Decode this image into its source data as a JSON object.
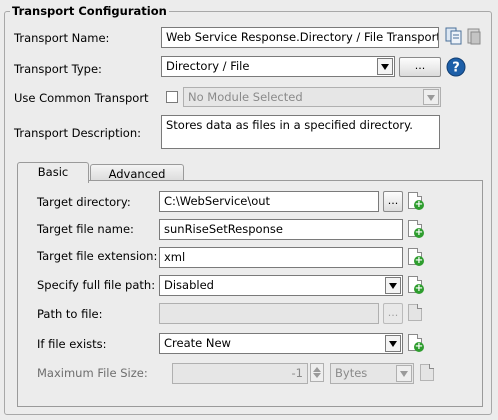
{
  "section_title": "Transport Configuration",
  "transport": {
    "name_label": "Transport Name:",
    "name_value": "Web Service Response.Directory / File Transport",
    "type_label": "Transport Type:",
    "type_value": "Directory / File",
    "type_browse": "...",
    "common_label": "Use Common Transport",
    "common_value": "No Module Selected",
    "desc_label": "Transport Description:",
    "desc_value": "Stores data as files in a specified directory."
  },
  "tabs": [
    {
      "label": "Basic",
      "active": true
    },
    {
      "label": "Advanced",
      "active": false
    }
  ],
  "basic": {
    "target_dir_label": "Target directory:",
    "target_dir_value": "C:\\WebService\\out",
    "browse_label": "...",
    "target_file_label": "Target file name:",
    "target_file_value": "sunRiseSetResponse",
    "target_ext_label": "Target file extension:",
    "target_ext_value": "xml",
    "full_path_label": "Specify full file path:",
    "full_path_value": "Disabled",
    "path_label": "Path to file:",
    "path_value": "",
    "path_browse": "...",
    "exists_label": "If file exists:",
    "exists_value": "Create New",
    "max_size_label": "Maximum File Size:",
    "max_size_value": "-1",
    "max_size_unit": "Bytes"
  },
  "icons": {
    "copy": "copy-icon",
    "add": "add-document-icon",
    "help": "help-icon",
    "help_glyph": "?"
  },
  "colors": {
    "background": "#ececec",
    "help_blue": "#1d5fa8",
    "add_green": "#2e9d2e"
  }
}
